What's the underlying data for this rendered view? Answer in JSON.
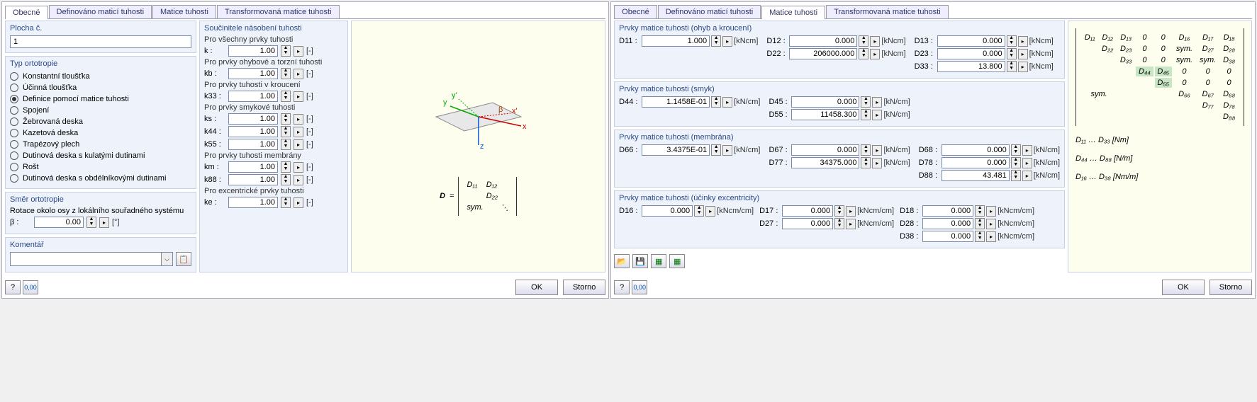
{
  "tabs": {
    "t0": "Obecné",
    "t1": "Definováno maticí tuhosti",
    "t2": "Matice tuhosti",
    "t3": "Transformovaná matice tuhosti"
  },
  "left": {
    "plocha_title": "Plocha č.",
    "plocha_value": "1",
    "typ_title": "Typ ortotropie",
    "opts": {
      "o0": "Konstantní tloušťka",
      "o1": "Účinná tloušťka",
      "o2": "Definice pomocí matice tuhosti",
      "o3": "Spojení",
      "o4": "Žebrovaná deska",
      "o5": "Kazetová deska",
      "o6": "Trapézový plech",
      "o7": "Dutinová deska s kulatými dutinami",
      "o8": "Rošt",
      "o9": "Dutinová deska s obdélníkovými dutinami"
    },
    "smer_title": "Směr ortotropie",
    "smer_label": "Rotace okolo osy z lokálního souřadného systému",
    "beta_label": "β :",
    "beta_value": "0.00",
    "beta_unit": "[°]",
    "komentar_title": "Komentář"
  },
  "mid": {
    "soucin_title": "Součinitele násobení tuhosti",
    "s0_head": "Pro všechny prvky tuhosti",
    "s0_label": "k :",
    "s0_val": "1.00",
    "s1_head": "Pro prvky ohybové a torzní tuhosti",
    "s1_label": "kb :",
    "s1_val": "1.00",
    "s2_head": "Pro prvky tuhosti v kroucení",
    "s2_label": "k33 :",
    "s2_val": "1.00",
    "s3_head": "Pro prvky smykové tuhosti",
    "s3a_label": "ks :",
    "s3a_val": "1.00",
    "s3b_label": "k44 :",
    "s3b_val": "1.00",
    "s3c_label": "k55 :",
    "s3c_val": "1.00",
    "s4_head": "Pro prvky tuhosti membrány",
    "s4a_label": "km :",
    "s4a_val": "1.00",
    "s4b_label": "k88 :",
    "s4b_val": "1.00",
    "s5_head": "Pro excentrické prvky tuhosti",
    "s5_label": "ke :",
    "s5_val": "1.00",
    "unit": "[-]"
  },
  "eq": {
    "D": "D",
    "eq": "=",
    "r0c0": "D₁₁",
    "r0c1": "D₁₂",
    "r1c1": "D₂₂",
    "sym": "sym.",
    "dots": "⋱"
  },
  "right": {
    "g1_title": "Prvky matice tuhosti (ohyb a kroucení)",
    "u_kNcm": "[kNcm]",
    "d11_l": "D11 :",
    "d11_v": "1.000",
    "d12_l": "D12 :",
    "d12_v": "0.000",
    "d13_l": "D13 :",
    "d13_v": "0.000",
    "d22_l": "D22 :",
    "d22_v": "206000.000",
    "d23_l": "D23 :",
    "d23_v": "0.000",
    "d33_l": "D33 :",
    "d33_v": "13.800",
    "g2_title": "Prvky matice tuhosti (smyk)",
    "u_kNpcm": "[kN/cm]",
    "d44_l": "D44 :",
    "d44_v": "1.1458E-01",
    "d45_l": "D45 :",
    "d45_v": "0.000",
    "d55_l": "D55 :",
    "d55_v": "11458.300",
    "g3_title": "Prvky matice tuhosti (membrána)",
    "d66_l": "D66 :",
    "d66_v": "3.4375E-01",
    "d67_l": "D67 :",
    "d67_v": "0.000",
    "d68_l": "D68 :",
    "d68_v": "0.000",
    "d77_l": "D77 :",
    "d77_v": "34375.000",
    "d78_l": "D78 :",
    "d78_v": "0.000",
    "d88_l": "D88 :",
    "d88_v": "43.481",
    "g4_title": "Prvky matice tuhosti (účinky excentricity)",
    "u_kNcmpcm": "[kNcm/cm]",
    "d16_l": "D16 :",
    "d16_v": "0.000",
    "d17_l": "D17 :",
    "d17_v": "0.000",
    "d18_l": "D18 :",
    "d18_v": "0.000",
    "d27_l": "D27 :",
    "d27_v": "0.000",
    "d28_l": "D28 :",
    "d28_v": "0.000",
    "d38_l": "D38 :",
    "d38_v": "0.000"
  },
  "matrix": {
    "r": {
      "c0": "D₁₁",
      "c1": "D₁₂",
      "c2": "D₁₃",
      "c3": "0",
      "c4": "0",
      "c5": "D₁₆",
      "c6": "D₁₇",
      "c7": "D₁₈",
      "r1c1": "D₂₂",
      "r1c2": "D₂₃",
      "r1c5": "sym.",
      "r1c6": "D₂₇",
      "r1c7": "D₂₈",
      "r2c2": "D₃₃",
      "r2c5": "sym.",
      "r2c6": "sym.",
      "r2c7": "D₃₈",
      "r3c3": "D₄₄",
      "r3c4": "D₄₅",
      "r4c4": "D₅₅",
      "r5c5": "D₆₆",
      "r5c6": "D₆₇",
      "r5c7": "D₆₈",
      "r6c6": "D₇₇",
      "r6c7": "D₇₈",
      "r7c7": "D₈₈",
      "sym": "sym."
    },
    "leg1": "D₁₁ … D₃₃  [Nm]",
    "leg2": "D₄₄ … D₈₈  [N/m]",
    "leg3": "D₁₆ … D₃₈  [Nm/m]"
  },
  "footer": {
    "ok": "OK",
    "storno": "Storno"
  }
}
